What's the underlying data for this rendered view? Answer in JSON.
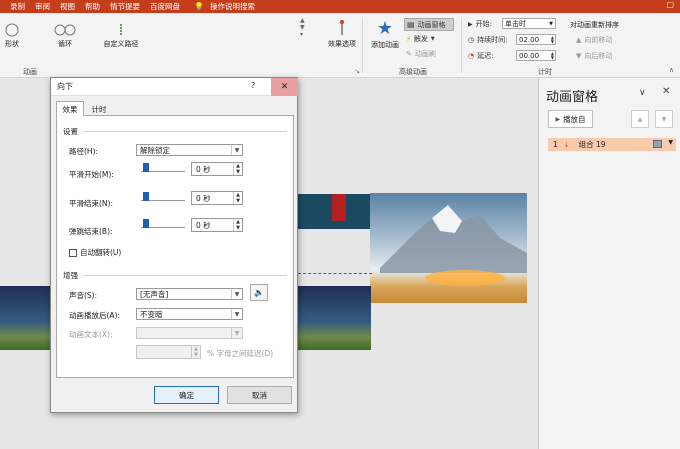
{
  "top_menu": {
    "tabs": [
      "录制",
      "审阅",
      "视图",
      "帮助",
      "情节提要",
      "百度网盘"
    ],
    "tell_me": "操作说明搜索"
  },
  "ribbon": {
    "anim_gallery": [
      "形状",
      "循环",
      "自定义路径"
    ],
    "effect_options": "效果选项",
    "group_anim_label": "动画",
    "add_animation": "添加动画",
    "animation_pane_btn": "动画窗格",
    "trigger": "触发",
    "anim_painter": "动画刷",
    "group_adv_label": "高级动画",
    "start_label": "开始:",
    "start_value": "单击时",
    "duration_label": "持续时间:",
    "duration_value": "02.00",
    "delay_label": "延迟:",
    "delay_value": "00.00",
    "reorder_title": "对动画重新排序",
    "move_earlier": "向前移动",
    "move_later": "向后移动",
    "group_timing_label": "计时",
    "colors": {
      "accent": "#c43e1c"
    }
  },
  "pane": {
    "title": "动画窗格",
    "play_btn": "播放自",
    "item_index": "1",
    "item_label": "组合 19",
    "item_color": "#f8cbad"
  },
  "dialog": {
    "title": "向下",
    "help": "?",
    "close": "✕",
    "tabs": [
      "效果",
      "计时"
    ],
    "settings_label": "设置",
    "path_label": "路径(H):",
    "path_value": "解除锁定",
    "smooth_start_label": "平滑开始(M):",
    "smooth_start_value": "0 秒",
    "smooth_end_label": "平滑结束(N):",
    "smooth_end_value": "0 秒",
    "bounce_end_label": "弹跳结束(B):",
    "bounce_end_value": "0 秒",
    "auto_reverse_label": "自动翻转(U)",
    "enhance_label": "增强",
    "sound_label": "声音(S):",
    "sound_value": "[无声音]",
    "after_anim_label": "动画播放后(A):",
    "after_anim_value": "不变暗",
    "anim_text_label": "动画文本(X):",
    "letter_delay_label": "% 字母之间延迟(D)",
    "ok": "确定",
    "cancel": "取消"
  }
}
